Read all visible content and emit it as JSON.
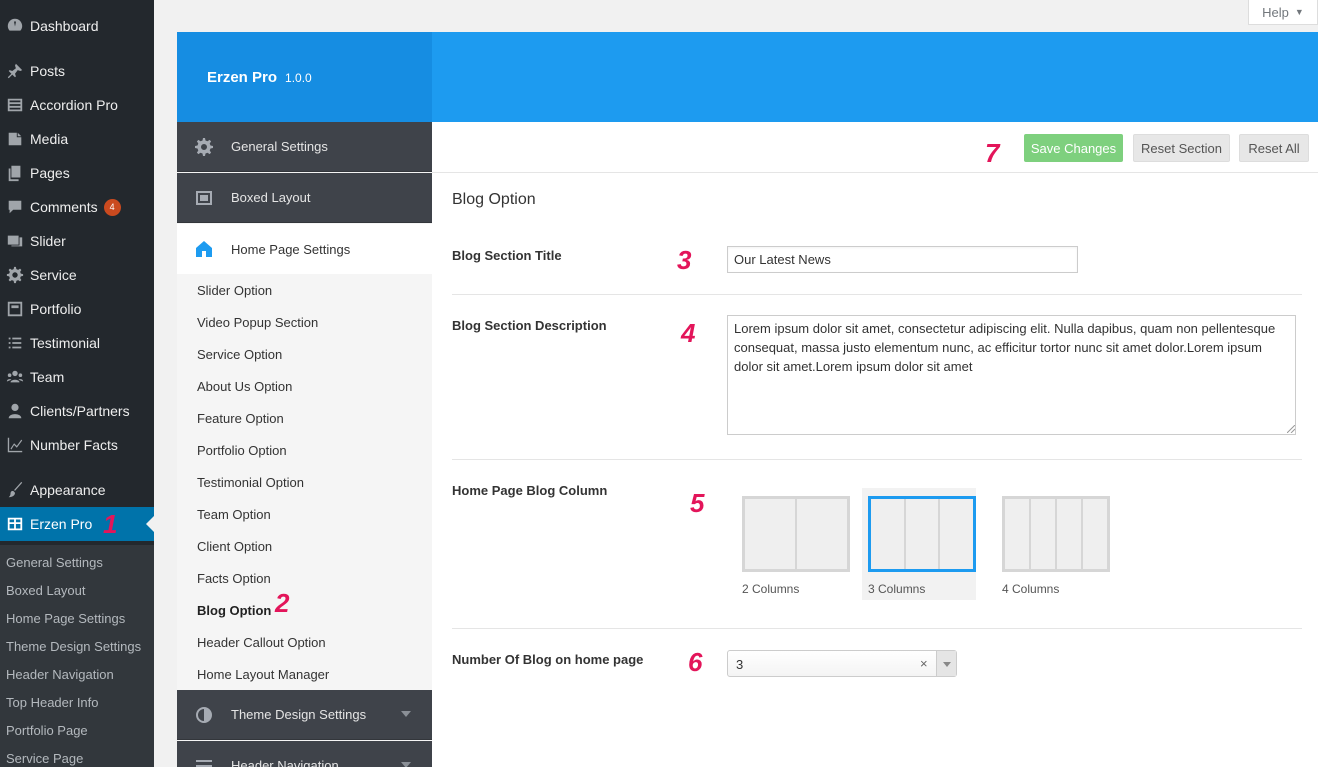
{
  "wp_menu": {
    "items": [
      {
        "label": "Dashboard",
        "icon": "dashboard-icon"
      },
      {
        "label": "Posts",
        "icon": "pin-icon"
      },
      {
        "label": "Accordion Pro",
        "icon": "accordion-icon"
      },
      {
        "label": "Media",
        "icon": "media-icon"
      },
      {
        "label": "Pages",
        "icon": "pages-icon"
      },
      {
        "label": "Comments",
        "icon": "comment-icon",
        "badge": "4"
      },
      {
        "label": "Slider",
        "icon": "slider-icon"
      },
      {
        "label": "Service",
        "icon": "gear-icon"
      },
      {
        "label": "Portfolio",
        "icon": "portfolio-icon"
      },
      {
        "label": "Testimonial",
        "icon": "list-icon"
      },
      {
        "label": "Team",
        "icon": "team-icon"
      },
      {
        "label": "Clients/Partners",
        "icon": "person-icon"
      },
      {
        "label": "Number Facts",
        "icon": "chart-icon"
      },
      {
        "label": "Appearance",
        "icon": "brush-icon"
      },
      {
        "label": "Erzen Pro",
        "icon": "erzen-icon",
        "active": true
      }
    ],
    "submenu": [
      "General Settings",
      "Boxed Layout",
      "Home Page Settings",
      "Theme Design Settings",
      "Header Navigation",
      "Top Header Info",
      "Portfolio Page",
      "Service Page"
    ]
  },
  "help_tab": {
    "label": "Help"
  },
  "panel": {
    "title": "Erzen Pro",
    "version": "1.0.0"
  },
  "sections": [
    {
      "label": "General Settings",
      "icon": "gear-icon"
    },
    {
      "label": "Boxed Layout",
      "icon": "box-icon"
    },
    {
      "label": "Home Page Settings",
      "icon": "home-icon",
      "active": true
    },
    {
      "label": "Theme Design Settings",
      "icon": "contrast-icon"
    },
    {
      "label": "Header Navigation",
      "icon": "menu-icon"
    }
  ],
  "home_subsections": [
    "Slider Option",
    "Video Popup Section",
    "Service Option",
    "About Us Option",
    "Feature Option",
    "Portfolio Option",
    "Testimonial Option",
    "Team Option",
    "Client Option",
    "Facts Option",
    "Blog Option",
    "Header Callout Option",
    "Home Layout Manager"
  ],
  "toolbar": {
    "save_label": "Save Changes",
    "reset_section_label": "Reset Section",
    "reset_all_label": "Reset All",
    "save_color": "#7ed07e"
  },
  "main": {
    "heading": "Blog Option",
    "fields": {
      "title_label": "Blog Section Title",
      "title_value": "Our Latest News",
      "desc_label": "Blog Section Description",
      "desc_value": "Lorem ipsum dolor sit amet, consectetur adipiscing elit. Nulla dapibus, quam non pellentesque consequat, massa justo elementum nunc, ac efficitur tortor nunc sit amet dolor.Lorem ipsum dolor sit amet.Lorem ipsum dolor sit amet",
      "column_label": "Home Page Blog Column",
      "column_options": [
        "2 Columns",
        "3 Columns",
        "4 Columns"
      ],
      "column_selected": "3 Columns",
      "count_label": "Number Of Blog on home page",
      "count_value": "3",
      "count_clear": "×"
    }
  },
  "annotations": [
    "1",
    "2",
    "3",
    "4",
    "5",
    "6",
    "7"
  ],
  "colors": {
    "wp_menu_bg": "#23282d",
    "accent_blue": "#1d9bf0",
    "active_menu": "#0073aa",
    "annotation": "#e3155a"
  }
}
